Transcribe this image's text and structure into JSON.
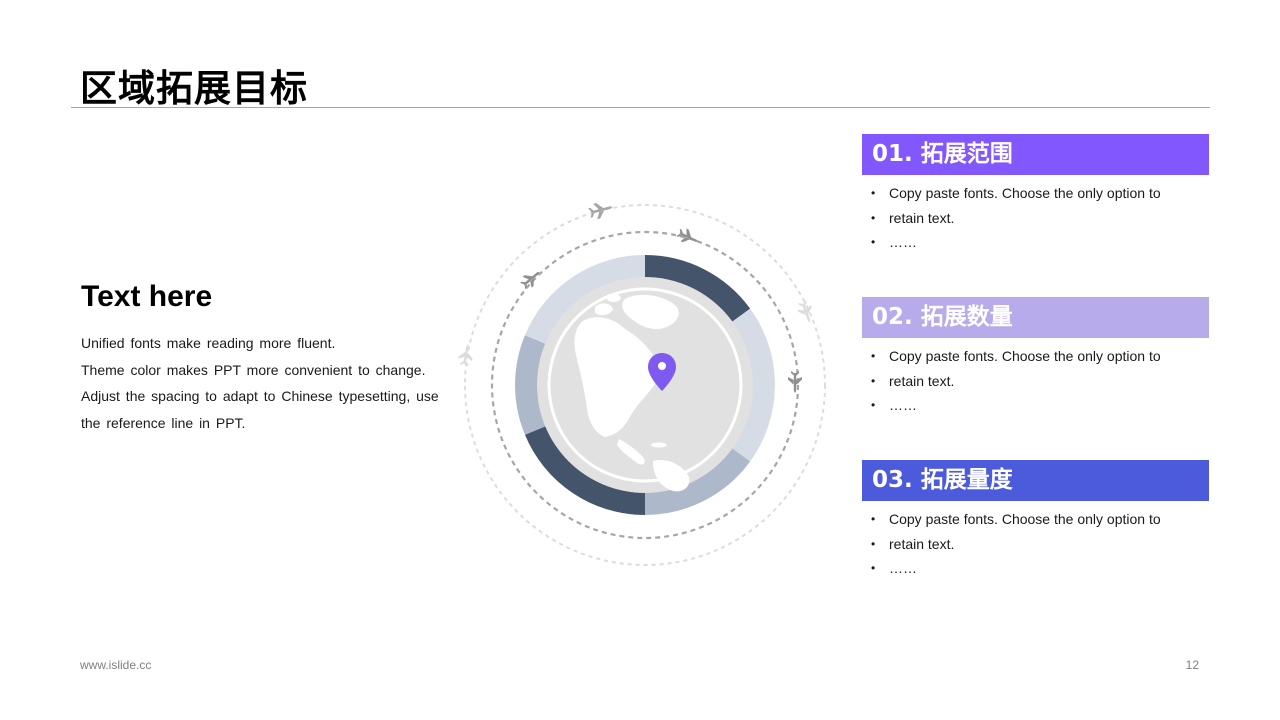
{
  "title": "区域拓展目标",
  "left": {
    "heading": "Text here",
    "lines": [
      "Unified fonts make reading more fluent.",
      "Theme color makes PPT more convenient to change.",
      "Adjust the spacing to adapt to Chinese typesetting, use",
      "the reference line in PPT."
    ]
  },
  "diagram": {
    "icons": [
      "airplane-icon",
      "map-pin-icon",
      "globe-americas-icon"
    ],
    "ring_colors": {
      "dark": "#44546A",
      "mid": "#ADB9CA",
      "light": "#D6DCE5"
    },
    "pin_color": "#7F5AF0"
  },
  "cards": [
    {
      "header": "01. 拓展范围",
      "color": "#8257FE",
      "bullets": [
        "Copy paste fonts. Choose the only option to",
        "retain text.",
        "……"
      ]
    },
    {
      "header": "02. 拓展数量",
      "color": "#B8ABEB",
      "bullets": [
        "Copy paste fonts. Choose the only option to",
        "retain text.",
        "……"
      ]
    },
    {
      "header": "03. 拓展量度",
      "color": "#4B5BDC",
      "bullets": [
        "Copy paste fonts. Choose the only option to",
        "retain text.",
        "……"
      ]
    }
  ],
  "footer": {
    "website": "www.islide.cc",
    "page_number": "12"
  }
}
